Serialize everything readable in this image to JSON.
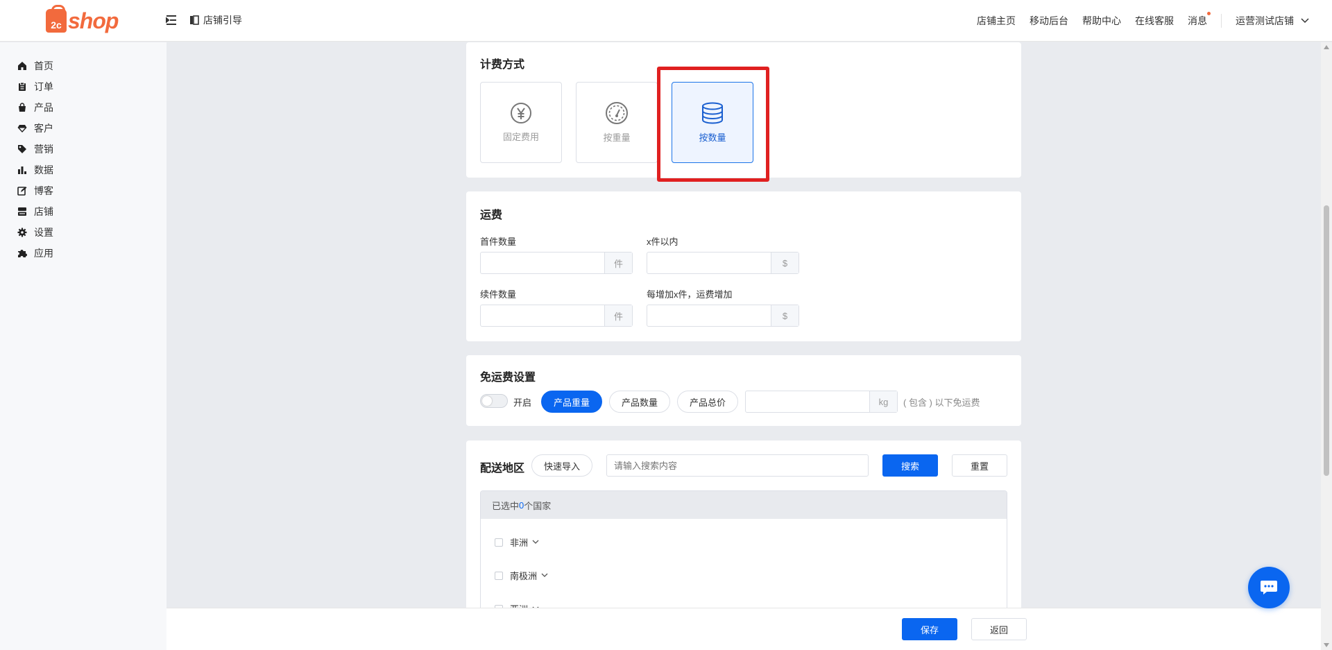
{
  "header": {
    "logo_prefix": "2c",
    "logo_text": "shop",
    "guide_label": "店铺引导",
    "links": [
      "店铺主页",
      "移动后台",
      "帮助中心",
      "在线客服",
      "消息"
    ],
    "store_name": "运营测试店铺"
  },
  "sidebar": {
    "items": [
      {
        "label": "首页",
        "icon": "home-icon"
      },
      {
        "label": "订单",
        "icon": "clipboard-icon"
      },
      {
        "label": "产品",
        "icon": "bag-icon"
      },
      {
        "label": "客户",
        "icon": "diamond-icon"
      },
      {
        "label": "营销",
        "icon": "tag-icon"
      },
      {
        "label": "数据",
        "icon": "bar-chart-icon"
      },
      {
        "label": "博客",
        "icon": "edit-icon"
      },
      {
        "label": "店铺",
        "icon": "store-icon"
      },
      {
        "label": "设置",
        "icon": "gear-icon"
      },
      {
        "label": "应用",
        "icon": "puzzle-icon"
      }
    ]
  },
  "billing": {
    "title": "计费方式",
    "options": [
      {
        "label": "固定费用",
        "icon": "yen-icon",
        "active": false
      },
      {
        "label": "按重量",
        "icon": "gauge-icon",
        "active": false
      },
      {
        "label": "按数量",
        "icon": "database-icon",
        "active": true
      }
    ]
  },
  "freight": {
    "title": "运费",
    "first_qty_label": "首件数量",
    "first_qty_value": "",
    "first_qty_unit": "件",
    "within_label": "x件以内",
    "within_value": "",
    "within_unit": "$",
    "extra_qty_label": "续件数量",
    "extra_qty_value": "",
    "extra_qty_unit": "件",
    "extra_fee_label": "每增加x件，运费增加",
    "extra_fee_value": "",
    "extra_fee_unit": "$"
  },
  "free_shipping": {
    "title": "免运费设置",
    "toggle_label": "开启",
    "toggle_on": false,
    "modes": [
      "产品重量",
      "产品数量",
      "产品总价"
    ],
    "active_mode": "产品重量",
    "threshold_value": "",
    "threshold_unit": "kg",
    "note": "( 包含 ) 以下免运费"
  },
  "delivery": {
    "title": "配送地区",
    "import_label": "快速导入",
    "search_placeholder": "请输入搜索内容",
    "search_label": "搜索",
    "reset_label": "重置",
    "selected_prefix": "已选中",
    "selected_count": "0",
    "selected_suffix": "个国家",
    "continents": [
      "非洲",
      "南极洲",
      "亚洲"
    ]
  },
  "footer": {
    "save_label": "保存",
    "back_label": "返回"
  },
  "colors": {
    "accent": "#0a66f0",
    "brand": "#f26a3d",
    "highlight": "#e02020"
  }
}
